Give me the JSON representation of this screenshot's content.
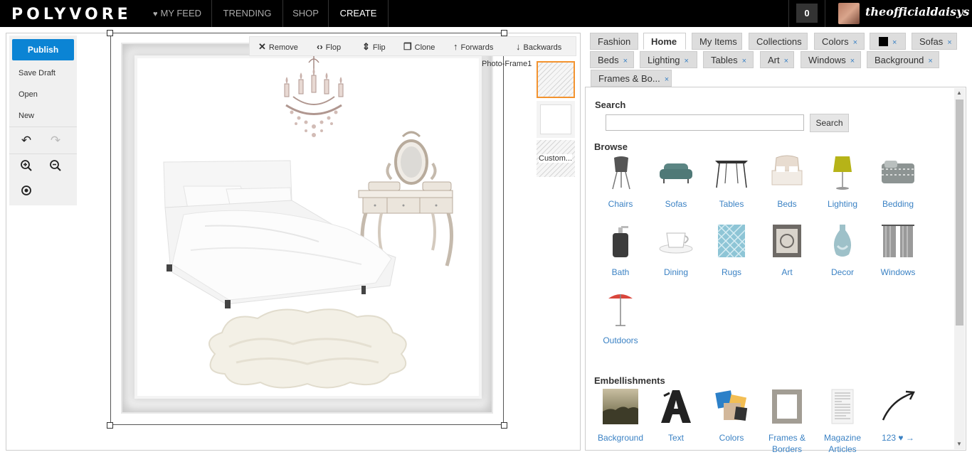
{
  "topbar": {
    "logo": "POLYVORE",
    "nav": [
      "MY FEED",
      "TRENDING",
      "SHOP",
      "CREATE"
    ],
    "active_nav": "CREATE",
    "notifications": "0",
    "username": "theofficialdaisys"
  },
  "toolbox": {
    "publish": "Publish",
    "save_draft": "Save Draft",
    "open": "Open",
    "new": "New",
    "icons": [
      "undo-icon",
      "redo-icon",
      "zoom-in-icon",
      "zoom-out-icon",
      "center-icon"
    ]
  },
  "context_bar": {
    "remove": "Remove",
    "flop": "Flop",
    "flip": "Flip",
    "clone": "Clone",
    "forwards": "Forwards",
    "backwards": "Backwards"
  },
  "layer": {
    "label": "Photo-Frame1",
    "swatches": [
      "",
      "",
      "Custom..."
    ]
  },
  "tabs": {
    "row1": [
      {
        "label": "Fashion",
        "closable": false
      },
      {
        "label": "Home",
        "closable": false,
        "active": true
      },
      {
        "label": "My Items",
        "closable": false
      },
      {
        "label": "Collections",
        "closable": false
      },
      {
        "label": "Colors",
        "closable": true
      },
      {
        "label": "",
        "closable": true,
        "swatch": "#000000"
      },
      {
        "label": "Sofas",
        "closable": true
      }
    ],
    "row2": [
      {
        "label": "Beds",
        "closable": true
      },
      {
        "label": "Lighting",
        "closable": true
      },
      {
        "label": "Tables",
        "closable": true
      },
      {
        "label": "Art",
        "closable": true
      },
      {
        "label": "Windows",
        "closable": true
      },
      {
        "label": "Background",
        "closable": true
      }
    ],
    "row3": [
      {
        "label": "Frames & Bo...",
        "closable": true
      }
    ],
    "close_glyph": "×"
  },
  "search": {
    "label": "Search",
    "placeholder": "",
    "button": "Search"
  },
  "browse": {
    "title": "Browse",
    "items": [
      "Chairs",
      "Sofas",
      "Tables",
      "Beds",
      "Lighting",
      "Bedding",
      "Bath",
      "Dining",
      "Rugs",
      "Art",
      "Decor",
      "Windows",
      "Outdoors"
    ]
  },
  "embellishments": {
    "title": "Embellishments",
    "items": [
      "Background",
      "Text",
      "Colors",
      "Frames & Borders",
      "Magazine Articles",
      "123 ♥ →"
    ]
  },
  "colors": {
    "accent": "#0b84d4",
    "link": "#3b82c4",
    "selection": "#f3932f"
  }
}
